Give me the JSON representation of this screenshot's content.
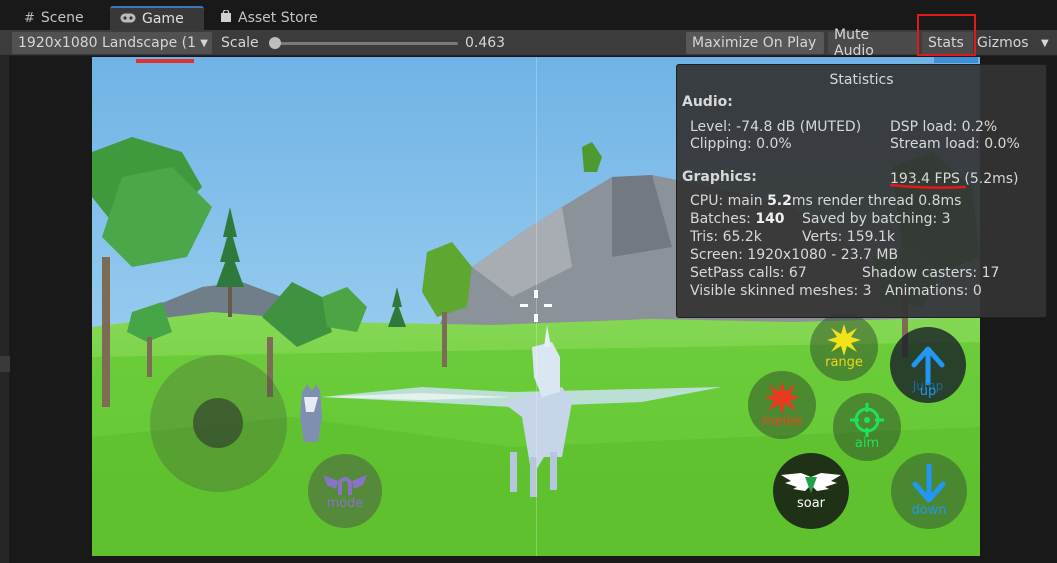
{
  "tabs": [
    {
      "label": "Scene",
      "icon": "grid-icon"
    },
    {
      "label": "Game",
      "icon": "gamepad-icon"
    },
    {
      "label": "Asset Store",
      "icon": "bag-icon"
    }
  ],
  "toolbar": {
    "resolution": "1920x1080 Landscape (1",
    "scale_label": "Scale",
    "scale_value": "0.463",
    "maximize_on_play": "Maximize On Play",
    "mute_audio": "Mute Audio",
    "stats": "Stats",
    "gizmos": "Gizmos"
  },
  "stats_panel": {
    "title": "Statistics",
    "audio_header": "Audio:",
    "level": "Level: -74.8 dB (MUTED)",
    "clipping": "Clipping: 0.0%",
    "dsp_load": "DSP load: 0.2%",
    "stream_load": "Stream load: 0.0%",
    "graphics_header": "Graphics:",
    "fps": "193.4 FPS",
    "fps_ms": "(5.2ms)",
    "cpu_prefix": "CPU: main ",
    "cpu_main": "5.2",
    "cpu_suffix": "ms  render thread 0.8ms",
    "batches_prefix": "Batches: ",
    "batches": "140",
    "saved_by_batching": "Saved by batching: 3",
    "tris": "Tris: 65.2k",
    "verts": "Verts: 159.1k",
    "screen": "Screen: 1920x1080 - 23.7 MB",
    "setpass": "SetPass calls: 67",
    "shadow_casters": "Shadow casters: 17",
    "skinned_meshes": "Visible skinned meshes: 3",
    "animations": "Animations: 0"
  },
  "controls": {
    "mode": "mode",
    "range": "range",
    "melee": "melee",
    "aim": "aim",
    "up": "up",
    "jump": "Jump",
    "soar": "soar",
    "down": "down"
  },
  "colors": {
    "accent_tab": "#3a79bb",
    "highlight_red": "#e01a1a",
    "grass": "#6fcf3c",
    "sky": "#82c2ec"
  }
}
